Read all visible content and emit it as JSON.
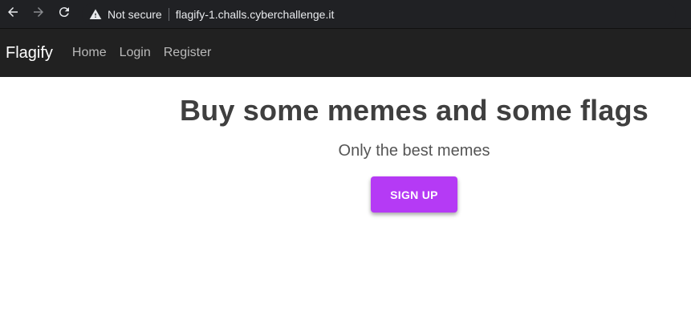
{
  "browser": {
    "security_label": "Not secure",
    "url": "flagify-1.challs.cyberchallenge.it",
    "icons": {
      "back": "back-arrow-icon",
      "forward": "forward-arrow-icon",
      "reload": "reload-icon",
      "warning": "warning-triangle-icon"
    }
  },
  "navbar": {
    "brand": "Flagify",
    "links": [
      {
        "label": "Home"
      },
      {
        "label": "Login"
      },
      {
        "label": "Register"
      }
    ]
  },
  "hero": {
    "title": "Buy some memes and some flags",
    "subtitle": "Only the best memes",
    "cta_label": "SIGN UP",
    "cta_color": "#b53af5"
  },
  "colors": {
    "browser_chrome": "#202124",
    "navbar_bg": "#212121",
    "page_bg": "#ffffff"
  }
}
